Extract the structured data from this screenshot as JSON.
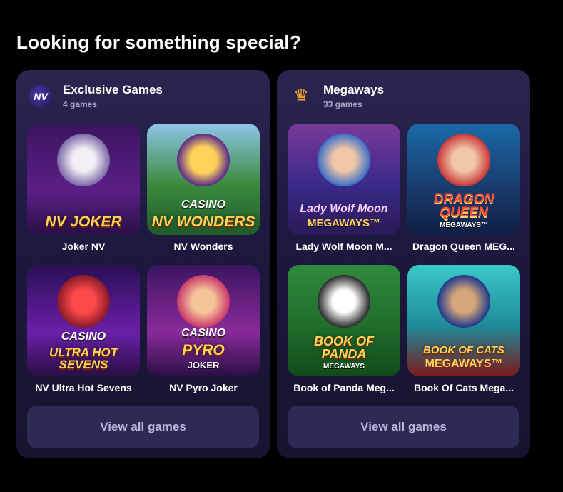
{
  "heading": "Looking for something special?",
  "panels": [
    {
      "title": "Exclusive Games",
      "subtitle": "4 games",
      "icon": "nv-casino-logo-icon",
      "games": [
        {
          "label": "Joker NV",
          "art_title": "NV JOKER",
          "art_brand": "",
          "art_sub": "",
          "bg": "#5b1f86",
          "art": "#d9d2e6"
        },
        {
          "label": "NV Wonders",
          "art_title": "NV WONDERS",
          "art_brand": "CASINO",
          "art_sub": "",
          "bg": "#2f7a3c",
          "art": "#c9a227"
        },
        {
          "label": "NV Ultra Hot Sevens",
          "art_title": "ULTRA HOT SEVENS",
          "art_brand": "CASINO",
          "art_sub": "",
          "bg": "#4a1a8a",
          "art": "#d62a3a"
        },
        {
          "label": "NV Pyro Joker",
          "art_title": "PYRO",
          "art_brand": "CASINO",
          "art_sub": "JOKER",
          "bg": "#6a1f7a",
          "art": "#e86a2a"
        }
      ],
      "view_all": "View all games"
    },
    {
      "title": "Megaways",
      "subtitle": "33 games",
      "icon": "crown-icon",
      "games": [
        {
          "label": "Lady Wolf Moon M...",
          "art_title": "Lady Wolf Moon",
          "art_brand": "",
          "art_sub": "MEGAWAYS™",
          "bg": "#4d2a8a",
          "art": "#3d6fc9"
        },
        {
          "label": "Dragon Queen MEG...",
          "art_title": "DRAGON QUEEN",
          "art_brand": "",
          "art_sub": "MEGAWAYS™",
          "bg": "#1f5a8a",
          "art": "#c93a3a"
        },
        {
          "label": "Book of Panda Meg...",
          "art_title": "BOOK OF PANDA",
          "art_brand": "",
          "art_sub": "MEGAWAYS",
          "bg": "#2f7a3c",
          "art": "#f0f0f0"
        },
        {
          "label": "Book Of Cats Mega...",
          "art_title": "BOOK OF CATS",
          "art_brand": "",
          "art_sub": "MEGAWAYS™",
          "bg": "#2a8a9a",
          "art": "#d6a53a"
        }
      ],
      "view_all": "View all games"
    }
  ]
}
